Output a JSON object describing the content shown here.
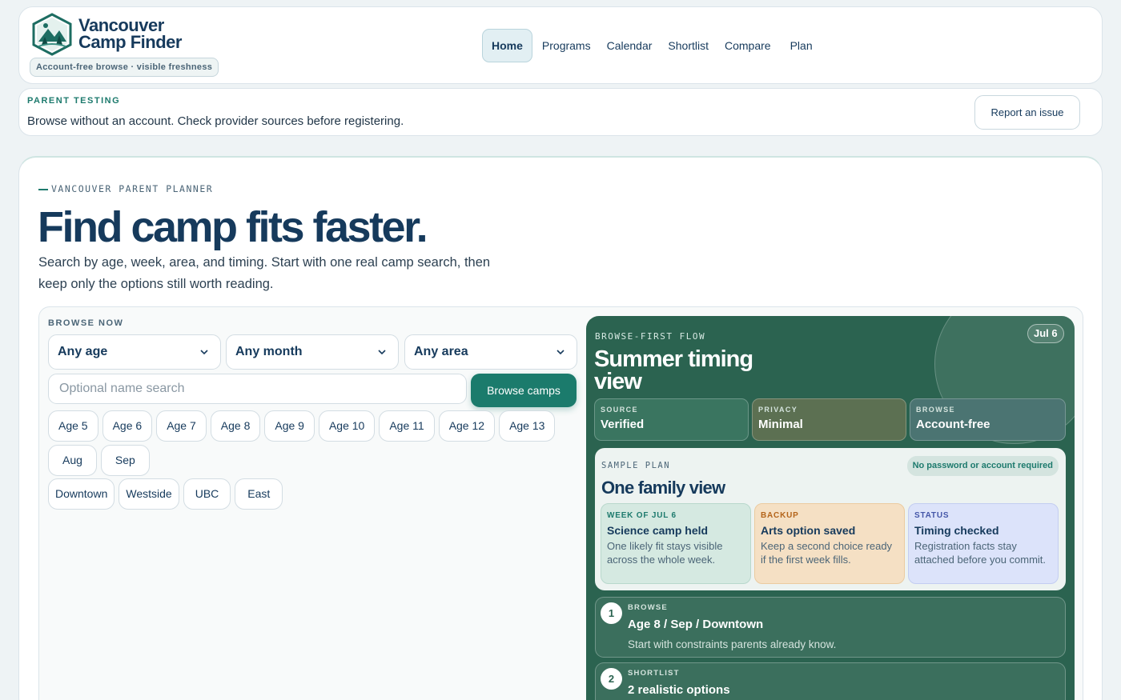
{
  "header": {
    "brand_line1": "Vancouver",
    "brand_line2": "Camp Finder",
    "tagline": "Account-free browse · visible freshness",
    "nav": [
      "Home",
      "Programs",
      "Calendar",
      "Shortlist",
      "Compare",
      "Plan"
    ]
  },
  "banner": {
    "eyebrow": "PARENT TESTING",
    "text": "Browse without an account. Check provider sources before registering.",
    "report_label": "Report an issue"
  },
  "hero": {
    "eyebrow": "VANCOUVER PARENT PLANNER",
    "title": "Find camp fits faster.",
    "subtitle": "Search by age, week, area, and timing. Start with one real camp search, then keep only the options still worth reading."
  },
  "browse": {
    "label": "BROWSE NOW",
    "age_select": "Any age",
    "month_select": "Any month",
    "area_select": "Any area",
    "search_placeholder": "Optional name search",
    "browse_button": "Browse camps",
    "age_chips": [
      "Age 5",
      "Age 6",
      "Age 7",
      "Age 8",
      "Age 9",
      "Age 10",
      "Age 11",
      "Age 12",
      "Age 13"
    ],
    "month_chips": [
      "Aug",
      "Sep"
    ],
    "area_chips": [
      "Downtown",
      "Westside",
      "UBC",
      "East"
    ]
  },
  "flow": {
    "eyebrow": "BROWSE-FIRST FLOW",
    "title": "Summer timing view",
    "date_pill": "Jul 6",
    "stats": [
      {
        "key": "SOURCE",
        "value": "Verified"
      },
      {
        "key": "PRIVACY",
        "value": "Minimal"
      },
      {
        "key": "BROWSE",
        "value": "Account-free"
      }
    ],
    "sample": {
      "eyebrow": "SAMPLE PLAN",
      "badge": "No password or account required",
      "title": "One family view",
      "cards": [
        {
          "key": "WEEK OF JUL 6",
          "title": "Science camp held",
          "desc": "One likely fit stays visible across the whole week."
        },
        {
          "key": "BACKUP",
          "title": "Arts option saved",
          "desc": "Keep a second choice ready if the first week fills."
        },
        {
          "key": "STATUS",
          "title": "Timing checked",
          "desc": "Registration facts stay attached before you commit."
        }
      ]
    },
    "steps": [
      {
        "num": "1",
        "key": "BROWSE",
        "title": "Age 8 / Sep / Downtown",
        "desc": "Start with constraints parents already know."
      },
      {
        "num": "2",
        "key": "SHORTLIST",
        "title": "2 realistic options",
        "desc": ""
      }
    ]
  },
  "colors": {
    "accent": "#1b7b6c",
    "navy": "#163a5c",
    "flow_panel": "#2b6350"
  }
}
